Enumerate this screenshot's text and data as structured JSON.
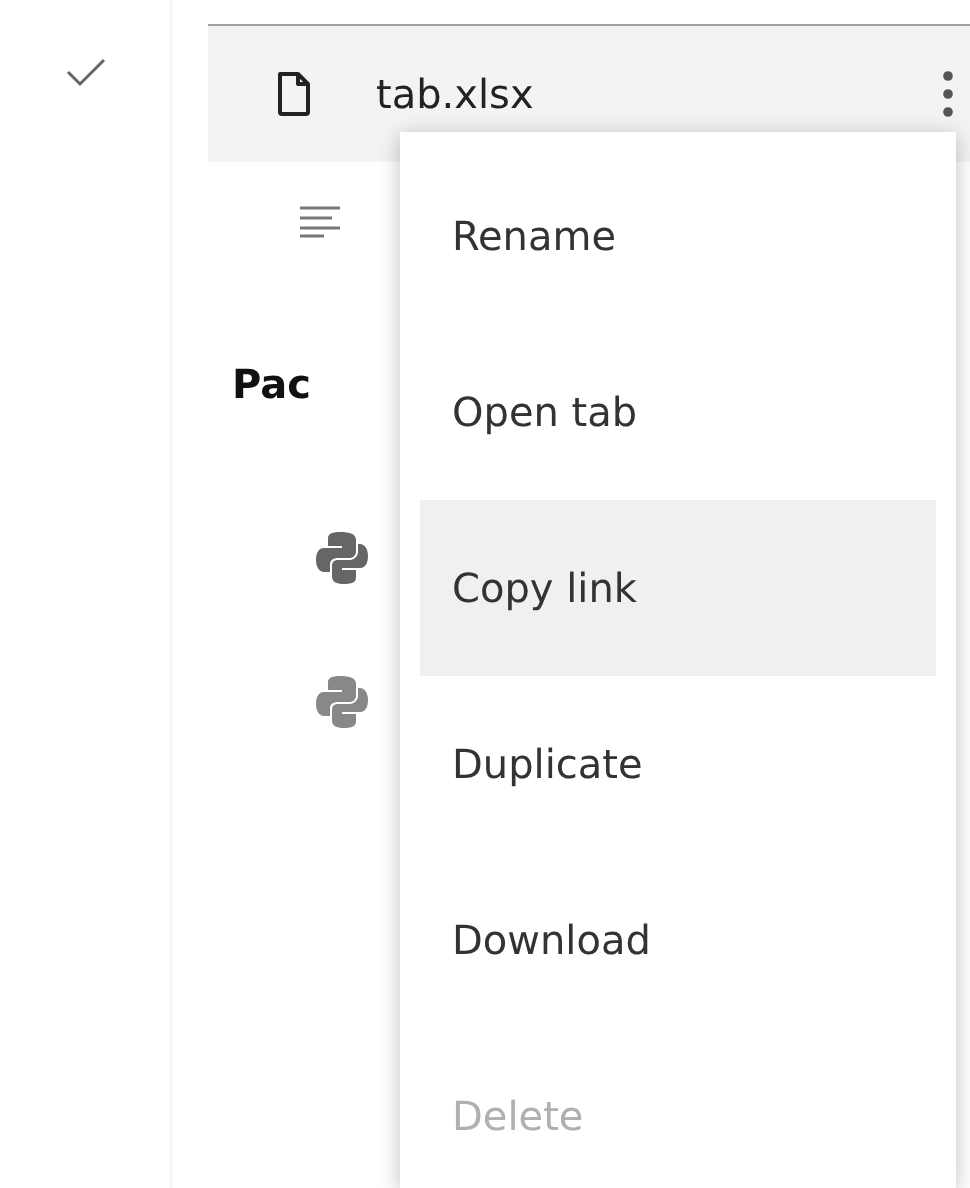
{
  "file_row": {
    "name": "tab.xlsx"
  },
  "section": {
    "heading": "Pac"
  },
  "menu": {
    "items": [
      {
        "label": "Rename",
        "selected": false,
        "disabled": false
      },
      {
        "label": "Open tab",
        "selected": false,
        "disabled": false
      },
      {
        "label": "Copy link",
        "selected": true,
        "disabled": false
      },
      {
        "label": "Duplicate",
        "selected": false,
        "disabled": false
      },
      {
        "label": "Download",
        "selected": false,
        "disabled": false
      },
      {
        "label": "Delete",
        "selected": false,
        "disabled": true
      }
    ]
  }
}
